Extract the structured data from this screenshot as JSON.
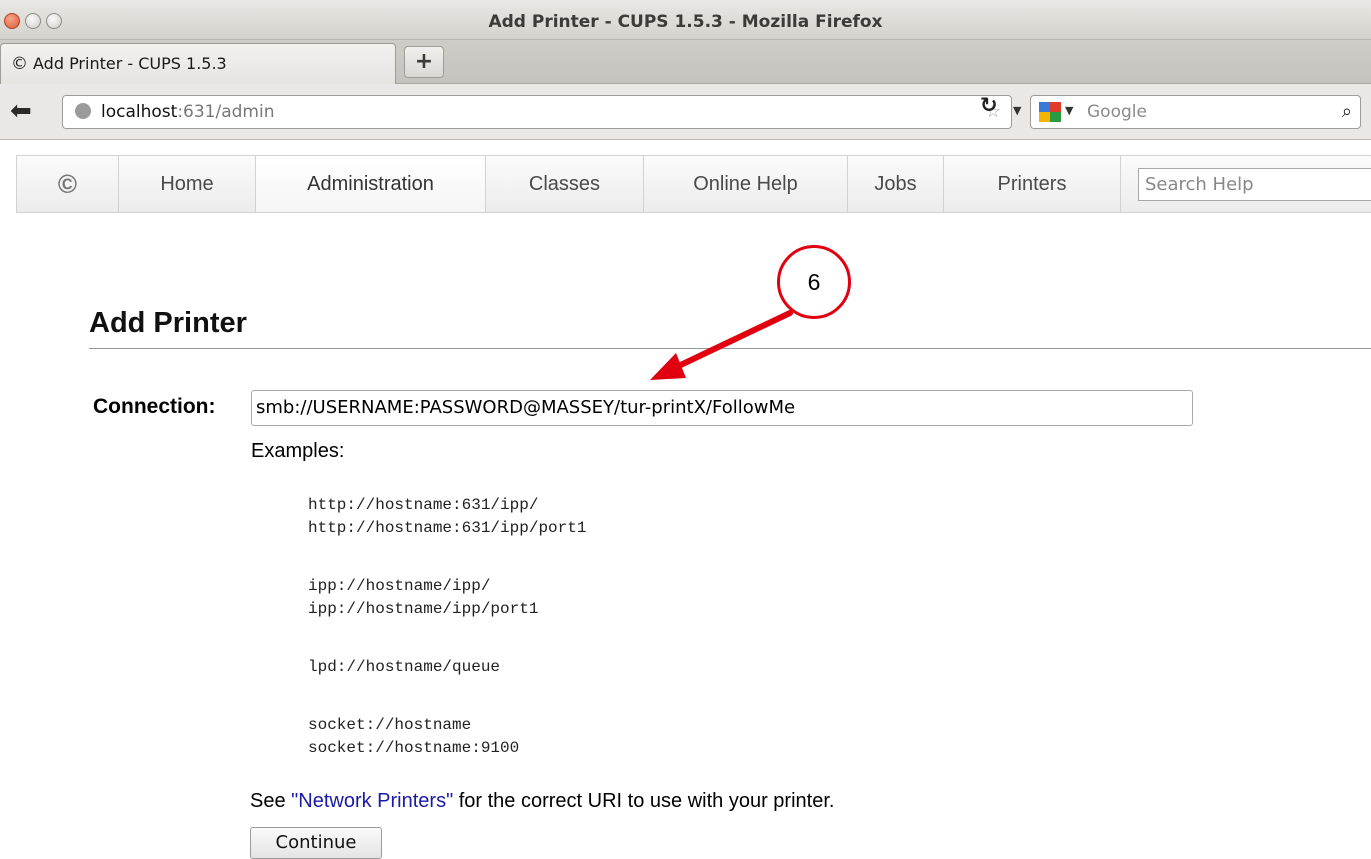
{
  "window": {
    "title": "Add Printer - CUPS 1.5.3 - Mozilla Firefox"
  },
  "browser": {
    "tab_title": "Add Printer - CUPS 1.5.3",
    "new_tab_label": "+",
    "url_host": "localhost",
    "url_rest": ":631/admin",
    "search_engine": "Google",
    "icons": [
      "back-arrow-icon",
      "globe-icon",
      "bookmark-star-icon",
      "dropdown-icon",
      "reload-icon",
      "google-icon",
      "search-icon"
    ]
  },
  "cups_nav": {
    "items": [
      {
        "label": "Home"
      },
      {
        "label": "Administration",
        "active": true
      },
      {
        "label": "Classes"
      },
      {
        "label": "Online Help"
      },
      {
        "label": "Jobs"
      },
      {
        "label": "Printers"
      }
    ],
    "search_placeholder": "Search Help"
  },
  "page": {
    "title": "Add Printer",
    "connection_label": "Connection:",
    "connection_value": "smb://USERNAME:PASSWORD@MASSEY/tur-printX/FollowMe",
    "examples_label": "Examples:",
    "examples": [
      [
        "http://hostname:631/ipp/",
        "http://hostname:631/ipp/port1"
      ],
      [
        "ipp://hostname/ipp/",
        "ipp://hostname/ipp/port1"
      ],
      [
        "lpd://hostname/queue"
      ],
      [
        "socket://hostname",
        "socket://hostname:9100"
      ]
    ],
    "note_prefix": "See ",
    "note_link": "\"Network Printers\"",
    "note_suffix": " for the correct URI to use with your printer.",
    "continue_label": "Continue"
  },
  "annotation": {
    "step_number": "6",
    "color": "#e0000f"
  }
}
